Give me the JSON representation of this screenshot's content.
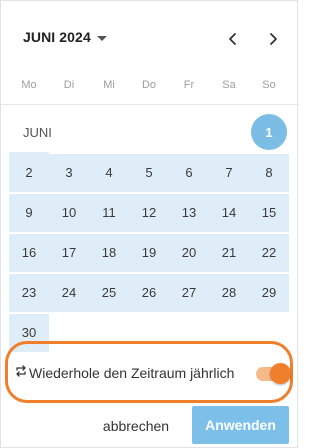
{
  "header": {
    "month_label": "JUNI 2024"
  },
  "weekdays": [
    "Mo",
    "Di",
    "Mi",
    "Do",
    "Fr",
    "Sa",
    "So"
  ],
  "calendar": {
    "month_name": "JUNI",
    "first_row": [
      {
        "day": "1",
        "selected": true
      },
      {
        "day": "2",
        "selected": false
      }
    ],
    "weeks": [
      [
        "3",
        "4",
        "5",
        "6",
        "7",
        "8",
        "9"
      ],
      [
        "10",
        "11",
        "12",
        "13",
        "14",
        "15",
        "16"
      ],
      [
        "17",
        "18",
        "19",
        "20",
        "21",
        "22",
        "23"
      ],
      [
        "24",
        "25",
        "26",
        "27",
        "28",
        "29",
        "30"
      ]
    ]
  },
  "repeat": {
    "label": "Wiederhole den Zeitraum jährlich",
    "enabled": true
  },
  "footer": {
    "cancel_label": "abbrechen",
    "apply_label": "Anwenden"
  },
  "colors": {
    "range": "#deedf8",
    "selected": "#7bbde4",
    "accent_orange": "#f07f2c",
    "apply_button": "#7cc0ea"
  }
}
